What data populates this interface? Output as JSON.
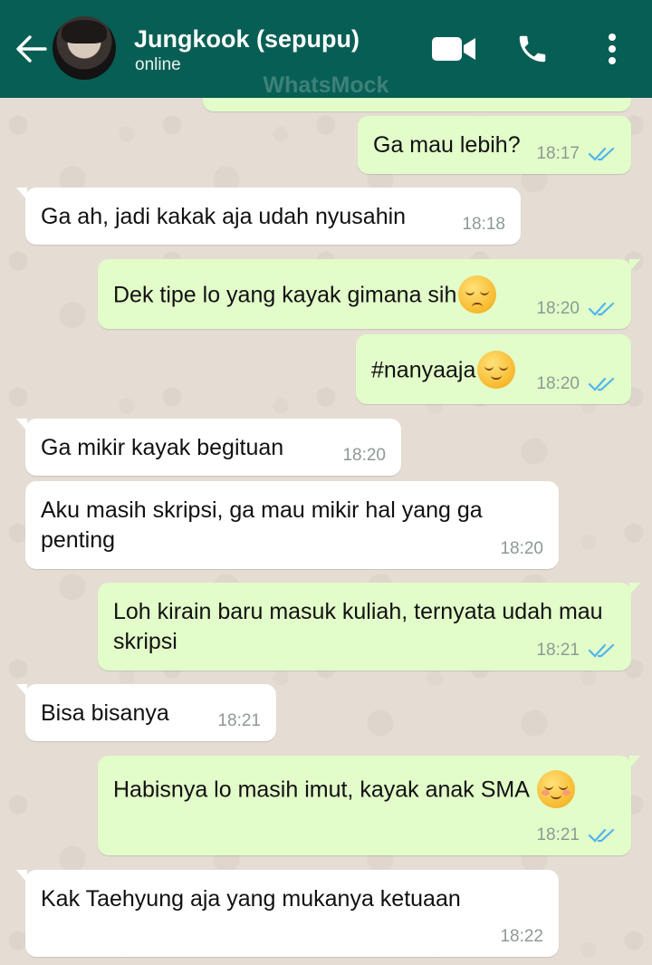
{
  "header": {
    "contact_name": "Jungkook (sepupu)",
    "status": "online",
    "watermark": "WhatsMock",
    "bg_color": "#075e54"
  },
  "messages": [
    {
      "dir": "out",
      "text": "Ga mau lebih?",
      "time": "18:17",
      "read": true
    },
    {
      "dir": "in",
      "text": "Ga ah, jadi kakak aja udah nyusahin",
      "time": "18:18"
    },
    {
      "dir": "out",
      "text": "Dek tipe lo yang kayak gimana sih",
      "emoji": "pensive-face",
      "time": "18:20",
      "read": true
    },
    {
      "dir": "out",
      "text": "#nanyaaja",
      "emoji": "relieved-face",
      "time": "18:20",
      "read": true
    },
    {
      "dir": "in",
      "text": "Ga mikir kayak begituan",
      "time": "18:20"
    },
    {
      "dir": "in",
      "text": "Aku masih skripsi, ga mau mikir hal yang ga penting",
      "time": "18:20"
    },
    {
      "dir": "out",
      "text": "Loh kirain baru masuk kuliah, ternyata udah mau skripsi",
      "time": "18:21",
      "read": true
    },
    {
      "dir": "in",
      "text": "Bisa bisanya",
      "time": "18:21"
    },
    {
      "dir": "out",
      "text": "Habisnya lo masih imut, kayak anak SMA",
      "emoji": "smiling-face",
      "time": "18:21",
      "read": true
    },
    {
      "dir": "in",
      "text": "Kak Taehyung aja yang mukanya ketuaan",
      "time": "18:22"
    }
  ],
  "colors": {
    "outgoing_bubble": "#e2fdc9",
    "incoming_bubble": "#ffffff",
    "read_ticks": "#4fb6ec"
  }
}
